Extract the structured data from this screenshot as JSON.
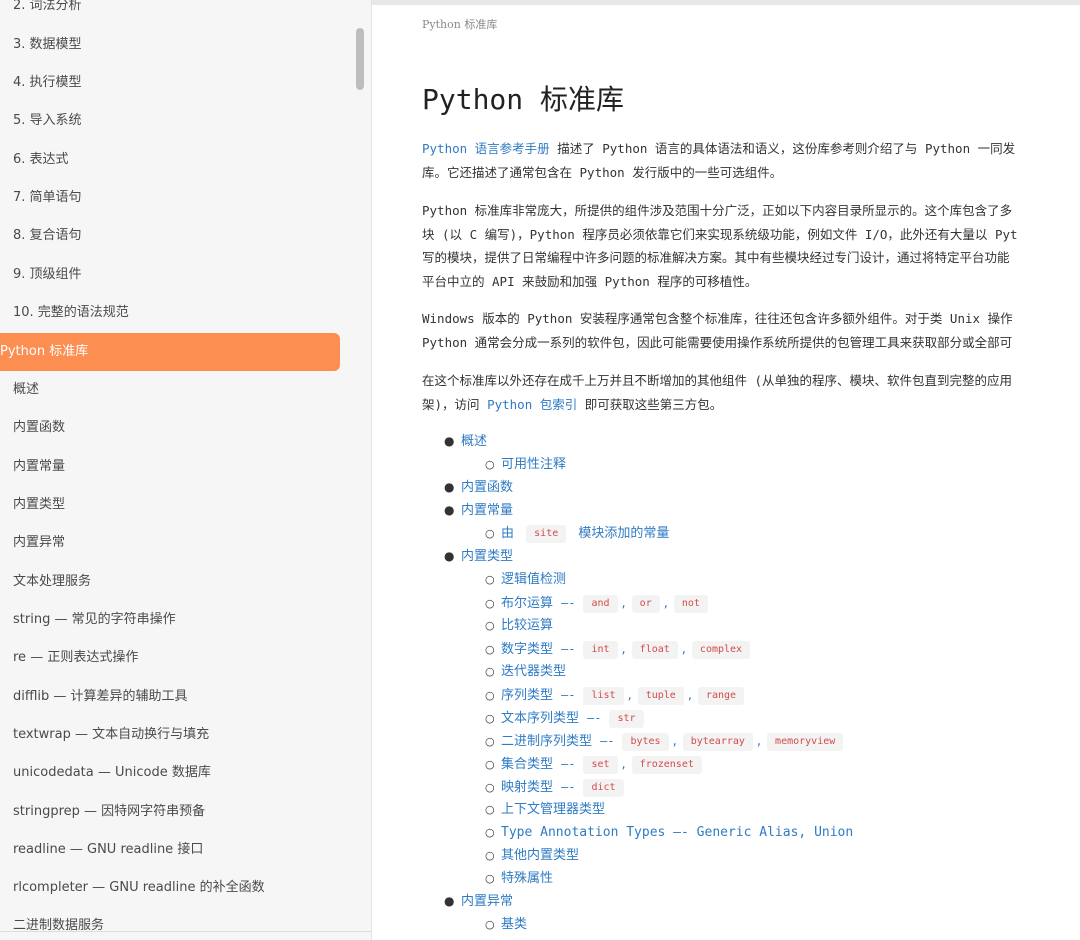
{
  "sidebar": {
    "items": [
      {
        "label": "2. 词法分析"
      },
      {
        "label": "3. 数据模型"
      },
      {
        "label": "4. 执行模型"
      },
      {
        "label": "5. 导入系统"
      },
      {
        "label": "6. 表达式"
      },
      {
        "label": "7. 简单语句"
      },
      {
        "label": "8. 复合语句"
      },
      {
        "label": "9. 顶级组件"
      },
      {
        "label": "10. 完整的语法规范"
      },
      {
        "label": "Python 标准库",
        "active": true
      },
      {
        "label": "概述"
      },
      {
        "label": "内置函数"
      },
      {
        "label": "内置常量"
      },
      {
        "label": "内置类型"
      },
      {
        "label": "内置异常"
      },
      {
        "label": "文本处理服务"
      },
      {
        "label": "string — 常见的字符串操作"
      },
      {
        "label": "re — 正则表达式操作"
      },
      {
        "label": "difflib — 计算差异的辅助工具"
      },
      {
        "label": "textwrap — 文本自动换行与填充"
      },
      {
        "label": "unicodedata — Unicode 数据库"
      },
      {
        "label": "stringprep — 因特网字符串预备"
      },
      {
        "label": "readline — GNU readline 接口"
      },
      {
        "label": "rlcompleter — GNU readline 的补全函数"
      },
      {
        "label": "二进制数据服务"
      }
    ],
    "active_color": "#fb8e50"
  },
  "main": {
    "breadcrumb": "Python 标准库",
    "title": "Python 标准库",
    "p1": {
      "link": "Python 语言参考手册",
      "line1_rest": " 描述了 Python 语言的具体语法和语义，这份库参考则介绍了与 Python 一同发",
      "line2": "库。它还描述了通常包含在 Python 发行版中的一些可选组件。"
    },
    "p2": {
      "line1": "Python 标准库非常庞大，所提供的组件涉及范围十分广泛，正如以下内容目录所显示的。这个库包含了多",
      "line2": "块 (以 C 编写)，Python 程序员必须依靠它们来实现系统级功能，例如文件 I/O，此外还有大量以 Pyt",
      "line3": "写的模块，提供了日常编程中许多问题的标准解决方案。其中有些模块经过专门设计，通过将特定平台功能",
      "line4": "平台中立的 API 来鼓励和加强 Python 程序的可移植性。"
    },
    "p3": {
      "line1": "Windows 版本的 Python 安装程序通常包含整个标准库，往往还包含许多额外组件。对于类 Unix 操作",
      "line2": "Python 通常会分成一系列的软件包，因此可能需要使用操作系统所提供的包管理工具来获取部分或全部可"
    },
    "p4": {
      "line1": "在这个标准库以外还存在成千上万并且不断增加的其他组件 (从单独的程序、模块、软件包直到完整的应用",
      "line2_pre": "架)，访问 ",
      "line2_link": "Python 包索引",
      "line2_post": " 即可获取这些第三方包。"
    },
    "toc": {
      "overview": "概述",
      "availability": "可用性注释",
      "builtin_functions": "内置函数",
      "builtin_constants": "内置常量",
      "site_pre": "由",
      "site_code": "site",
      "site_post": "模块添加的常量",
      "builtin_types": "内置类型",
      "truth": "逻辑值检测",
      "boolean": "布尔运算",
      "bool_codes": [
        "and",
        "or",
        "not"
      ],
      "comparisons": "比较运算",
      "numeric": "数字类型",
      "numeric_codes": [
        "int",
        "float",
        "complex"
      ],
      "iterator": "迭代器类型",
      "sequence": "序列类型",
      "sequence_codes": [
        "list",
        "tuple",
        "range"
      ],
      "text_sequence": "文本序列类型",
      "text_codes": [
        "str"
      ],
      "binary_sequence": "二进制序列类型",
      "binary_codes": [
        "bytes",
        "bytearray",
        "memoryview"
      ],
      "set_types": "集合类型",
      "set_codes": [
        "set",
        "frozenset"
      ],
      "mapping": "映射类型",
      "mapping_codes": [
        "dict"
      ],
      "context_manager": "上下文管理器类型",
      "type_annotation": "Type Annotation Types —- Generic Alias, Union",
      "other_builtin": "其他内置类型",
      "special_attrs": "特殊属性",
      "builtin_exceptions": "内置异常",
      "base_classes": "基类",
      "sep": "—-",
      "comma": ","
    }
  }
}
